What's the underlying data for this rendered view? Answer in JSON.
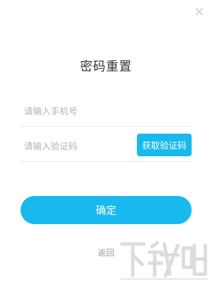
{
  "dialog": {
    "title": "密码重置",
    "close_icon": "close-icon"
  },
  "form": {
    "phone_placeholder": "请输入手机号",
    "phone_value": "",
    "code_placeholder": "请输入验证码",
    "code_value": "",
    "get_code_label": "获取验证码",
    "confirm_label": "确定",
    "back_label": "返回"
  },
  "watermark": {
    "icon": "site-watermark-logo"
  },
  "colors": {
    "accent": "#18b9ee",
    "title": "#333333",
    "placeholder": "#b3b3b3",
    "divider": "#e6e6e6",
    "link": "#999999"
  }
}
